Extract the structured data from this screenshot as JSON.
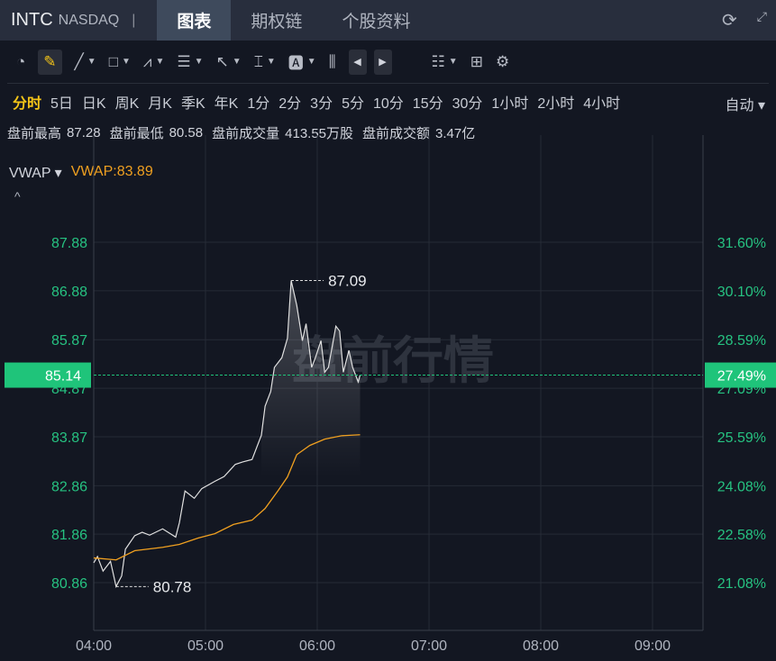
{
  "header": {
    "symbol": "INTC",
    "exchange": "NASDAQ",
    "separator": "|",
    "tabs": [
      "图表",
      "期权链",
      "个股资料"
    ],
    "active_tab": "图表"
  },
  "toolbar": {
    "icons": [
      "speedometer-icon",
      "pencil-icon",
      "line-icon",
      "rectangle-icon",
      "pattern-icon",
      "fibonacci-icon",
      "arrow-icon",
      "measure-icon",
      "text-icon",
      "candles-icon",
      "prev-icon",
      "next-icon",
      "layout-icon",
      "grid-icon",
      "gear-icon"
    ]
  },
  "periods": {
    "items": [
      "分时",
      "5日",
      "日K",
      "周K",
      "月K",
      "季K",
      "年K",
      "1分",
      "2分",
      "3分",
      "5分",
      "10分",
      "15分",
      "30分",
      "1小时",
      "2小时",
      "4小时"
    ],
    "active": "分时",
    "mode": "自动"
  },
  "stats": {
    "items": [
      {
        "label": "盘前最高",
        "value": "87.28"
      },
      {
        "label": "盘前最低",
        "value": "80.58"
      },
      {
        "label": "盘前成交量",
        "value": "413.55万股"
      },
      {
        "label": "盘前成交额",
        "value": "3.47亿"
      }
    ]
  },
  "indicator": {
    "name": "VWAP",
    "value_label": "VWAP:83.89",
    "collapse": "^"
  },
  "colors": {
    "price": "#e0e0e0",
    "vwap": "#f0a020",
    "axis_green": "#26c281",
    "current": "#1fc47a"
  },
  "chart_data": {
    "type": "line",
    "title": "盘前行情",
    "x_ticks": [
      "04:00",
      "05:00",
      "06:00",
      "07:00",
      "08:00",
      "09:00"
    ],
    "x_unit": "minutes since 04:00",
    "xlim": [
      0,
      327
    ],
    "y_ticks": [
      "87.88",
      "86.88",
      "85.87",
      "84.87",
      "83.87",
      "82.86",
      "81.86",
      "80.86"
    ],
    "y_right_ticks": [
      "31.60%",
      "30.10%",
      "28.59%",
      "27.09%",
      "25.59%",
      "24.08%",
      "22.58%",
      "21.08%"
    ],
    "ylim": [
      79.9,
      89.4
    ],
    "current_price": "85.14",
    "current_pct": "27.49%",
    "high_label": "87.09",
    "low_label": "80.78",
    "series": [
      {
        "name": "price",
        "points": [
          [
            0,
            81.27
          ],
          [
            2,
            81.4
          ],
          [
            5,
            81.1
          ],
          [
            9,
            81.3
          ],
          [
            12,
            80.78
          ],
          [
            15,
            81.0
          ],
          [
            17,
            81.55
          ],
          [
            22,
            81.83
          ],
          [
            26,
            81.9
          ],
          [
            30,
            81.84
          ],
          [
            37,
            81.97
          ],
          [
            44,
            81.8
          ],
          [
            46,
            82.1
          ],
          [
            49,
            82.75
          ],
          [
            54,
            82.6
          ],
          [
            58,
            82.8
          ],
          [
            65,
            82.95
          ],
          [
            70,
            83.05
          ],
          [
            76,
            83.3
          ],
          [
            80,
            83.35
          ],
          [
            85,
            83.4
          ],
          [
            90,
            83.9
          ],
          [
            92,
            84.5
          ],
          [
            95,
            84.8
          ],
          [
            97,
            85.3
          ],
          [
            101,
            85.5
          ],
          [
            104,
            85.9
          ],
          [
            106,
            87.09
          ],
          [
            109,
            86.58
          ],
          [
            112,
            85.85
          ],
          [
            114,
            86.2
          ],
          [
            117,
            85.3
          ],
          [
            119,
            85.5
          ],
          [
            122,
            85.85
          ],
          [
            124,
            85.2
          ],
          [
            126,
            85.3
          ],
          [
            130,
            86.15
          ],
          [
            132,
            86.05
          ],
          [
            134,
            85.2
          ],
          [
            137,
            85.65
          ],
          [
            139,
            85.3
          ],
          [
            142,
            85.0
          ],
          [
            143,
            85.14
          ]
        ]
      },
      {
        "name": "VWAP",
        "points": [
          [
            0,
            81.37
          ],
          [
            12,
            81.33
          ],
          [
            22,
            81.52
          ],
          [
            37,
            81.59
          ],
          [
            46,
            81.65
          ],
          [
            56,
            81.78
          ],
          [
            65,
            81.87
          ],
          [
            75,
            82.06
          ],
          [
            85,
            82.15
          ],
          [
            92,
            82.39
          ],
          [
            99,
            82.76
          ],
          [
            104,
            83.04
          ],
          [
            109,
            83.5
          ],
          [
            116,
            83.69
          ],
          [
            124,
            83.82
          ],
          [
            133,
            83.89
          ],
          [
            143,
            83.91
          ]
        ]
      }
    ]
  }
}
